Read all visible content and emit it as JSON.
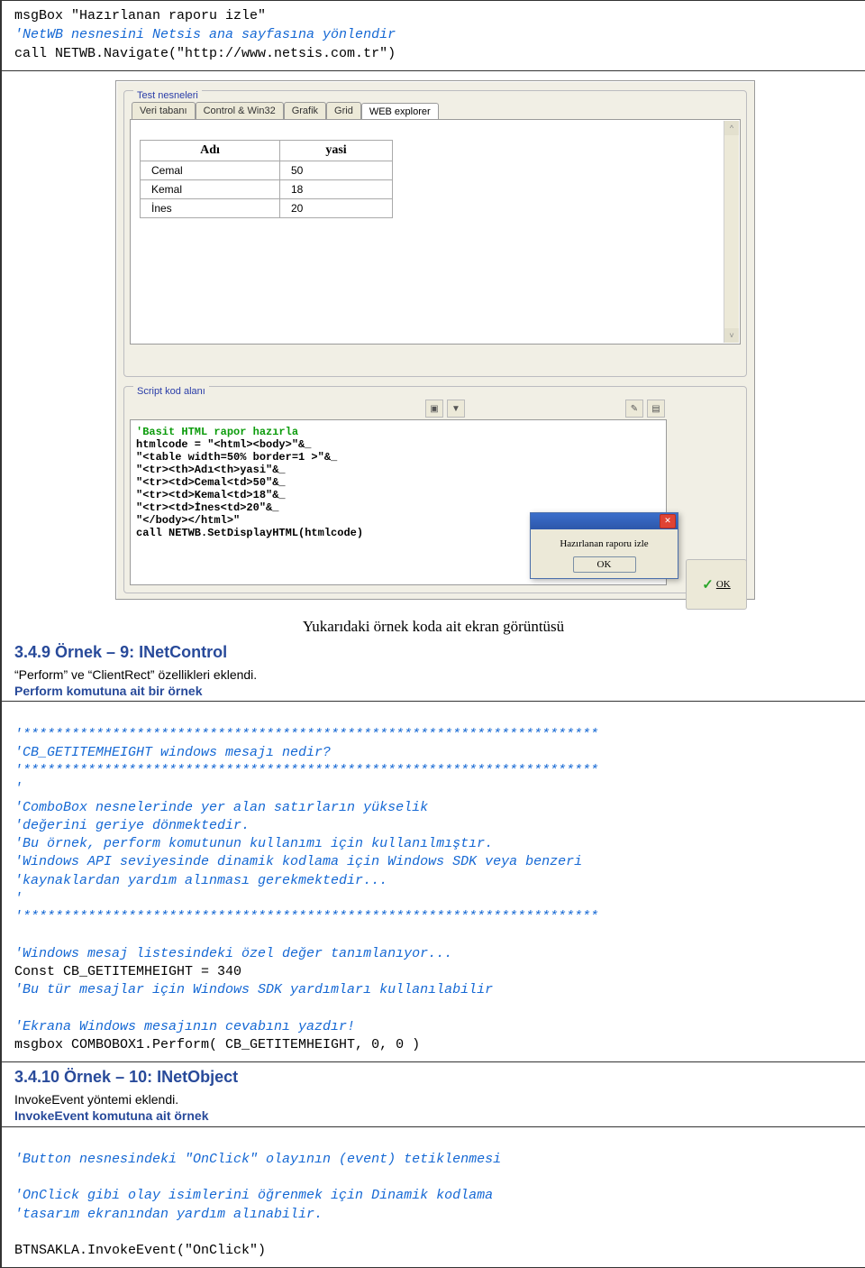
{
  "top_code": {
    "l1": "msgBox \"Hazırlanan raporu izle\"",
    "l2": "",
    "l3": "'NetWB nesnesini Netsis ana sayfasına yönlendir",
    "l4": "call NETWB.Navigate(\"http://www.netsis.com.tr\")"
  },
  "screenshot": {
    "group_title_1": "Test nesneleri",
    "tabs": [
      "Veri tabanı",
      "Control & Win32",
      "Grafik",
      "Grid",
      "WEB explorer"
    ],
    "active_tab": 4,
    "table": {
      "headers": [
        "Adı",
        "yasi"
      ],
      "rows": [
        [
          "Cemal",
          "50"
        ],
        [
          "Kemal",
          "18"
        ],
        [
          "İnes",
          "20"
        ]
      ]
    },
    "group_title_2": "Script kod alanı",
    "script_lines": [
      {
        "t": "'Basit HTML rapor hazırla",
        "c": "green"
      },
      {
        "t": "htmlcode = \"<html><body>\"&_",
        "c": ""
      },
      {
        "t": "\"<table width=50% border=1 >\"&_",
        "c": ""
      },
      {
        "t": "\"<tr><th>Adı<th>yasi\"&_",
        "c": ""
      },
      {
        "t": "\"<tr><td>Cemal<td>50\"&_",
        "c": ""
      },
      {
        "t": "\"<tr><td>Kemal<td>18\"&_",
        "c": ""
      },
      {
        "t": "\"<tr><td>İnes<td>20\"&_",
        "c": ""
      },
      {
        "t": "\"</body></html>\"",
        "c": ""
      },
      {
        "t": "call NETWB.SetDisplayHTML(htmlcode)",
        "c": ""
      }
    ],
    "ok_side_label": "OK",
    "msgbox_text": "Hazırlanan raporu izle",
    "msgbox_ok": "OK"
  },
  "caption": "Yukarıdaki örnek koda ait ekran görüntüsü",
  "sec9_title": "3.4.9 Örnek – 9: INetControl",
  "sec9_para": "“Perform” ve “ClientRect” özellikleri eklendi.",
  "sec9_link": "Perform komutuna ait bir örnek",
  "codeblock1": {
    "stars1": "'***********************************************************************",
    "c1": "'CB_GETITEMHEIGHT windows mesajı nedir?",
    "stars2": "'***********************************************************************",
    "tick": "'",
    "c2": "'ComboBox nesnelerinde yer alan satırların yükselik",
    "c3": "'değerini geriye dönmektedir.",
    "c4": "'Bu örnek, perform komutunun kullanımı için kullanılmıştır.",
    "c5": "'Windows API seviyesinde dinamik kodlama için Windows SDK veya benzeri",
    "c6": "'kaynaklardan yardım alınması gerekmektedir...",
    "tick2": "'",
    "stars3": "'***********************************************************************",
    "blank1": "",
    "c7": "'Windows mesaj listesindeki özel değer tanımlanıyor...",
    "l1": "Const CB_GETITEMHEIGHT = 340",
    "c8": "'Bu tür mesajlar için Windows SDK yardımları kullanılabilir",
    "blank2": "",
    "c9": "'Ekrana Windows mesajının cevabını yazdır!",
    "l2": "msgbox COMBOBOX1.Perform( CB_GETITEMHEIGHT, 0, 0 )"
  },
  "sec10_title": "3.4.10 Örnek – 10: INetObject",
  "sec10_para": "InvokeEvent yöntemi eklendi.",
  "sec10_link": "InvokeEvent komutuna ait örnek",
  "codeblock2": {
    "c1": "'Button nesnesindeki \"OnClick\" olayının (event) tetiklenmesi",
    "blank1": "",
    "c2": "'OnClick gibi olay isimlerini öğrenmek için Dinamik kodlama",
    "c3": "'tasarım ekranından yardım alınabilir.",
    "blank2": "",
    "l1": "BTNSAKLA.InvokeEvent(\"OnClick\")"
  }
}
